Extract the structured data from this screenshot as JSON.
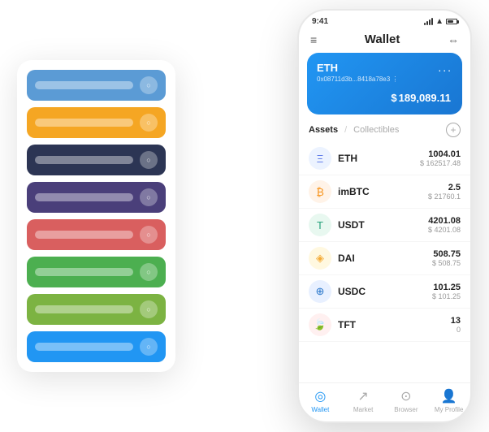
{
  "scene": {
    "phone": {
      "status_bar": {
        "time": "9:41",
        "wifi": "wifi",
        "signal": "signal"
      },
      "header": {
        "menu_icon": "≡",
        "title": "Wallet",
        "expand_icon": "⇔"
      },
      "eth_card": {
        "label": "ETH",
        "dots": "...",
        "address": "0x08711d3b...8418a78e3 ⋮",
        "currency_symbol": "$",
        "balance": "189,089.11"
      },
      "assets_section": {
        "active_tab": "Assets",
        "divider": "/",
        "inactive_tab": "Collectibles",
        "add_button": "+"
      },
      "assets": [
        {
          "id": "eth",
          "icon": "Ξ",
          "name": "ETH",
          "amount": "1004.01",
          "value": "$ 162517.48",
          "icon_class": "eth-icon"
        },
        {
          "id": "imbtc",
          "icon": "₿",
          "name": "imBTC",
          "amount": "2.5",
          "value": "$ 21760.1",
          "icon_class": "imbtc-icon"
        },
        {
          "id": "usdt",
          "icon": "T",
          "name": "USDT",
          "amount": "4201.08",
          "value": "$ 4201.08",
          "icon_class": "usdt-icon"
        },
        {
          "id": "dai",
          "icon": "◈",
          "name": "DAI",
          "amount": "508.75",
          "value": "$ 508.75",
          "icon_class": "dai-icon"
        },
        {
          "id": "usdc",
          "icon": "⊕",
          "name": "USDC",
          "amount": "101.25",
          "value": "$ 101.25",
          "icon_class": "usdc-icon"
        },
        {
          "id": "tft",
          "icon": "🍃",
          "name": "TFT",
          "amount": "13",
          "value": "0",
          "icon_class": "tft-icon"
        }
      ],
      "bottom_nav": [
        {
          "id": "wallet",
          "icon": "◎",
          "label": "Wallet",
          "active": true
        },
        {
          "id": "market",
          "icon": "↗",
          "label": "Market",
          "active": false
        },
        {
          "id": "browser",
          "icon": "⊙",
          "label": "Browser",
          "active": false
        },
        {
          "id": "profile",
          "icon": "👤",
          "label": "My Profile",
          "active": false
        }
      ]
    },
    "card_stack": {
      "cards": [
        {
          "color": "#5B9BD5",
          "bar_width": "65%"
        },
        {
          "color": "#F5A623",
          "bar_width": "75%"
        },
        {
          "color": "#2C3554",
          "bar_width": "55%"
        },
        {
          "color": "#4A3F7A",
          "bar_width": "70%"
        },
        {
          "color": "#D95F5F",
          "bar_width": "60%"
        },
        {
          "color": "#4CAF50",
          "bar_width": "80%"
        },
        {
          "color": "#7CB342",
          "bar_width": "50%"
        },
        {
          "color": "#2196F3",
          "bar_width": "65%"
        }
      ]
    }
  }
}
